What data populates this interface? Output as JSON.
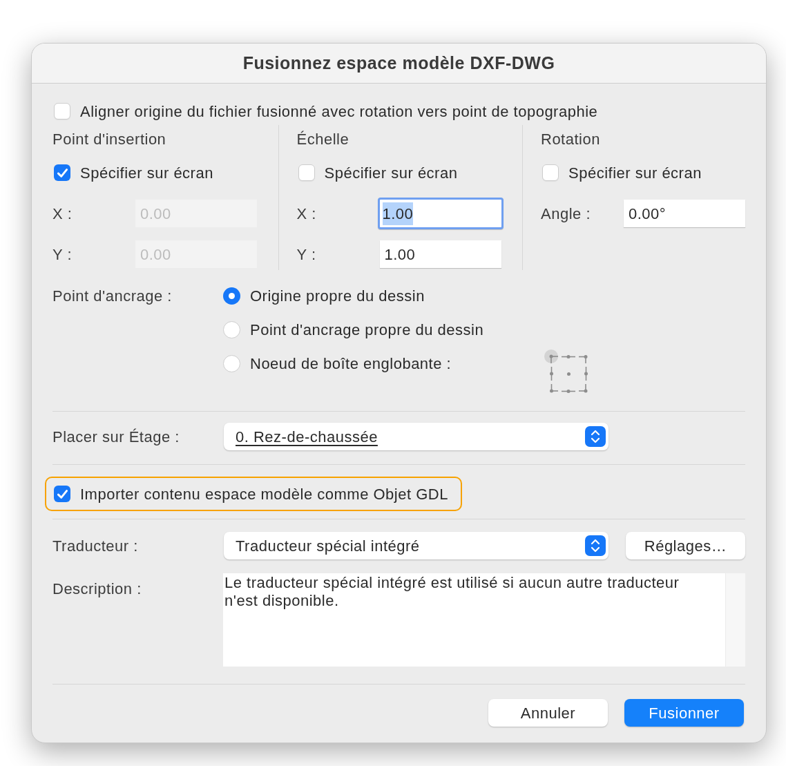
{
  "window": {
    "title": "Fusionnez espace modèle DXF-DWG"
  },
  "align_origin": {
    "label": "Aligner origine du fichier fusionné avec rotation vers point de topographie",
    "checked": false
  },
  "groups": [
    {
      "heading": "Point d'insertion",
      "specify": {
        "label": "Spécifier sur écran",
        "checked": true
      },
      "fields": [
        {
          "label": "X :",
          "value": "0.00",
          "disabled": true,
          "focused": false
        },
        {
          "label": "Y :",
          "value": "0.00",
          "disabled": true,
          "focused": false
        }
      ]
    },
    {
      "heading": "Échelle",
      "specify": {
        "label": "Spécifier sur écran",
        "checked": false
      },
      "fields": [
        {
          "label": "X :",
          "value": "1.00",
          "disabled": false,
          "focused": true
        },
        {
          "label": "Y :",
          "value": "1.00",
          "disabled": false,
          "focused": false
        }
      ]
    },
    {
      "heading": "Rotation",
      "specify": {
        "label": "Spécifier sur écran",
        "checked": false
      },
      "fields": [
        {
          "label": "Angle :",
          "value": "0.00°",
          "disabled": false,
          "focused": false
        }
      ]
    }
  ],
  "anchor": {
    "label": "Point d'ancrage :",
    "options": [
      {
        "label": "Origine propre du dessin",
        "selected": true
      },
      {
        "label": "Point d'ancrage propre du dessin",
        "selected": false
      },
      {
        "label": "Noeud de boîte englobante :",
        "selected": false
      }
    ],
    "nodes": [
      {
        "selected": true
      },
      {
        "selected": false
      },
      {
        "selected": false
      },
      {
        "selected": false
      },
      {
        "selected": false
      },
      {
        "selected": false
      },
      {
        "selected": false
      },
      {
        "selected": false
      },
      {
        "selected": false
      }
    ]
  },
  "story": {
    "label": "Placer sur Étage :",
    "value": "0. Rez-de-chaussée"
  },
  "import_gdl": {
    "label": "Importer contenu espace modèle comme Objet GDL",
    "checked": true,
    "highlighted": true
  },
  "translator": {
    "label": "Traducteur :",
    "value": "Traducteur spécial intégré",
    "settings_button": "Réglages…"
  },
  "description": {
    "label": "Description :",
    "text": "Le traducteur spécial intégré est utilisé si aucun autre traducteur n'est disponible."
  },
  "buttons": [
    {
      "label": "Annuler",
      "kind": "secondary"
    },
    {
      "label": "Fusionner",
      "kind": "primary"
    }
  ]
}
